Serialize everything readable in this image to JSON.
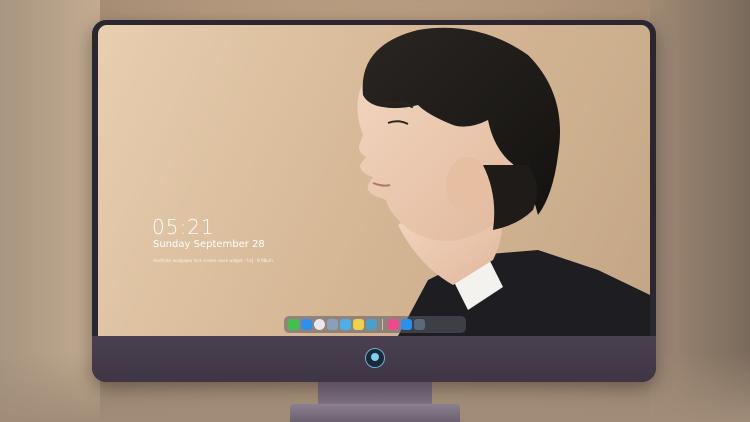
{
  "lockscreen": {
    "time": "05:21",
    "date": "Sunday September  28",
    "subtext": "Aesthetic wallpaper lock screen clock widget · ไม่รู้ · 8 ปีที่แล้ว"
  },
  "dock": {
    "items": [
      {
        "name": "messages-icon",
        "color": "#3fc24a"
      },
      {
        "name": "finder-icon",
        "color": "#2f8ff0"
      },
      {
        "name": "safari-icon",
        "color": "#e8e8ee"
      },
      {
        "name": "preview-icon",
        "color": "#8aa0b8"
      },
      {
        "name": "claquette-icon",
        "color": "#4ab0e8"
      },
      {
        "name": "notes-icon",
        "color": "#f2d24a"
      },
      {
        "name": "photos-icon",
        "color": "#4aa0c8"
      },
      {
        "name": "music-icon",
        "color": "#f04a8a"
      },
      {
        "name": "app-store-icon",
        "color": "#2a90f0"
      },
      {
        "name": "camera-icon",
        "color": "#5a6a7a"
      }
    ]
  },
  "colors": {
    "monitor_body": "#2a2730",
    "chin": "#4a4050",
    "accent": "#7fd0f0"
  }
}
